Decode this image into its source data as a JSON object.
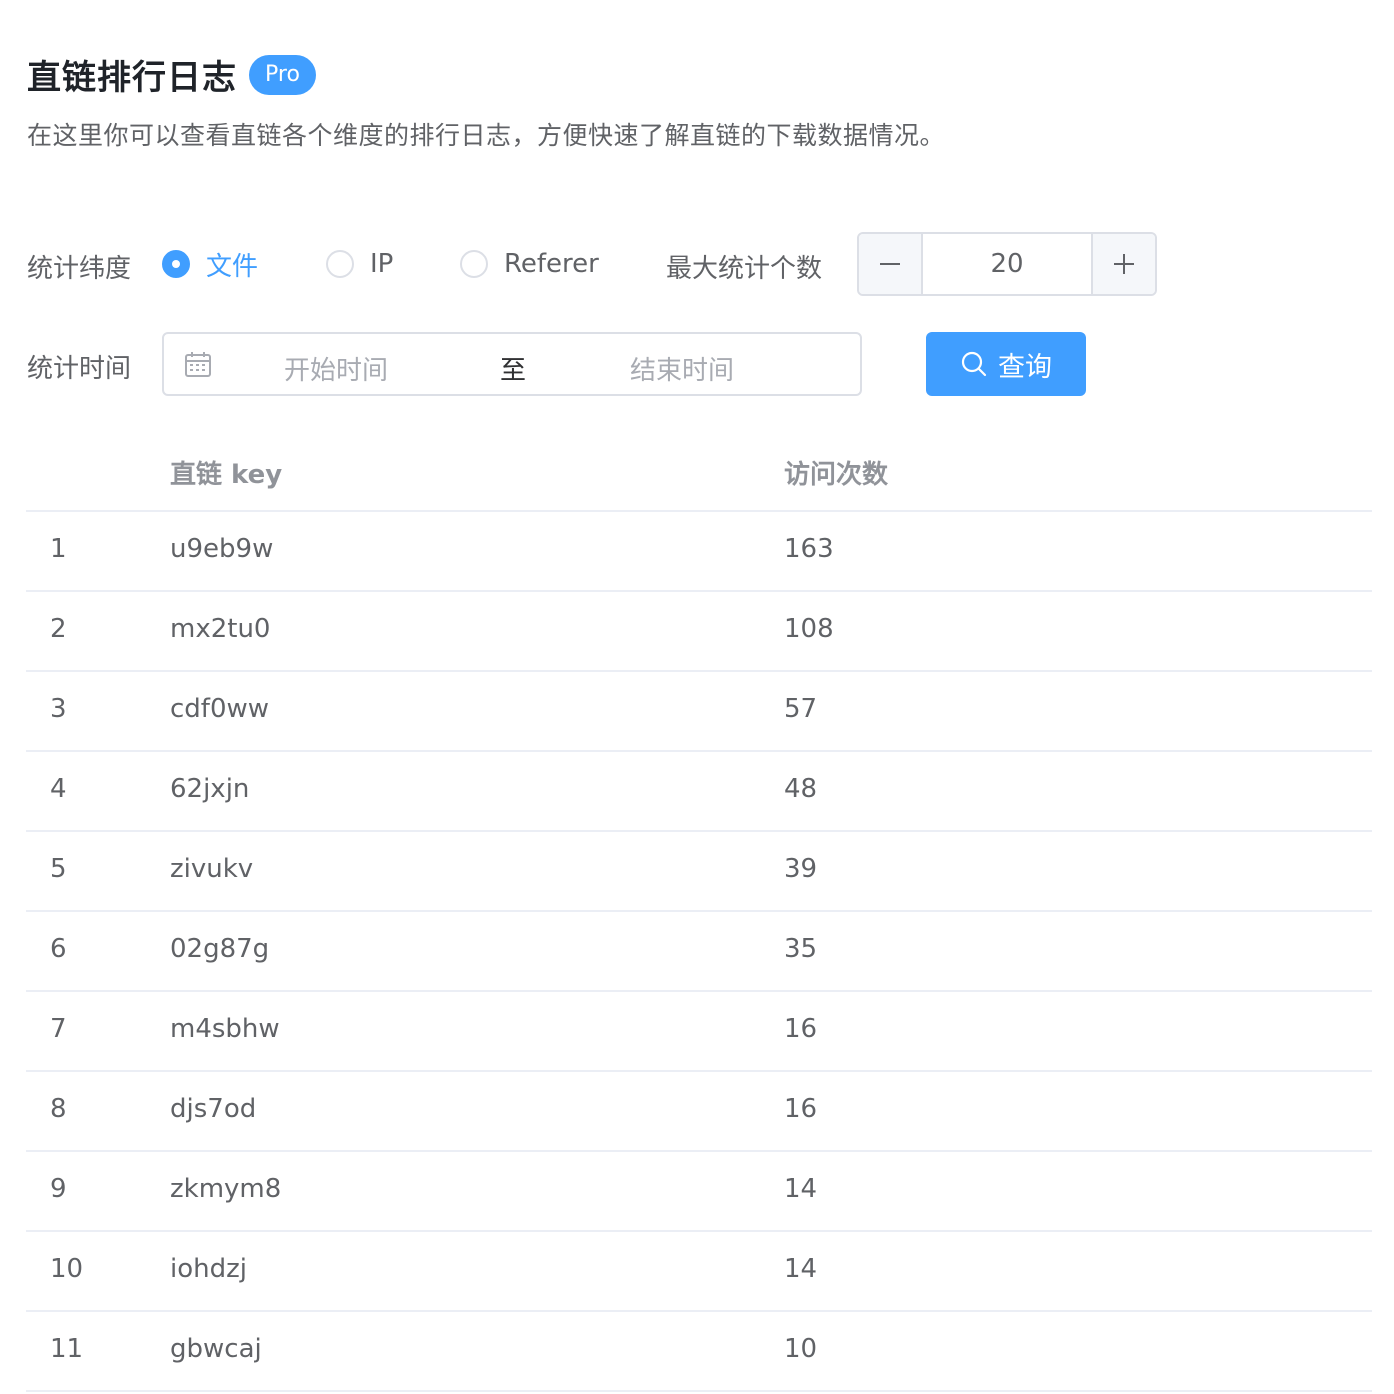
{
  "header": {
    "title": "直链排行日志",
    "badge": "Pro",
    "description": "在这里你可以查看直链各个维度的排行日志，方便快速了解直链的下载数据情况。"
  },
  "filters": {
    "dimension_label": "统计纬度",
    "dimension_options": [
      {
        "label": "文件",
        "checked": true
      },
      {
        "label": "IP",
        "checked": false
      },
      {
        "label": "Referer",
        "checked": false
      }
    ],
    "max_count_label": "最大统计个数",
    "max_count_value": "20",
    "time_label": "统计时间",
    "start_placeholder": "开始时间",
    "range_separator": "至",
    "end_placeholder": "结束时间",
    "query_label": "查询"
  },
  "table": {
    "headers": [
      "",
      "直链 key",
      "访问次数"
    ],
    "rows": [
      {
        "index": "1",
        "key": "u9eb9w",
        "count": "163"
      },
      {
        "index": "2",
        "key": "mx2tu0",
        "count": "108"
      },
      {
        "index": "3",
        "key": "cdf0ww",
        "count": "57"
      },
      {
        "index": "4",
        "key": "62jxjn",
        "count": "48"
      },
      {
        "index": "5",
        "key": "zivukv",
        "count": "39"
      },
      {
        "index": "6",
        "key": "02g87g",
        "count": "35"
      },
      {
        "index": "7",
        "key": "m4sbhw",
        "count": "16"
      },
      {
        "index": "8",
        "key": "djs7od",
        "count": "16"
      },
      {
        "index": "9",
        "key": "zkmym8",
        "count": "14"
      },
      {
        "index": "10",
        "key": "iohdzj",
        "count": "14"
      },
      {
        "index": "11",
        "key": "gbwcaj",
        "count": "10"
      }
    ]
  },
  "colors": {
    "primary": "#409eff",
    "border": "#dcdfe6",
    "text": "#606266",
    "header_text": "#909399"
  }
}
